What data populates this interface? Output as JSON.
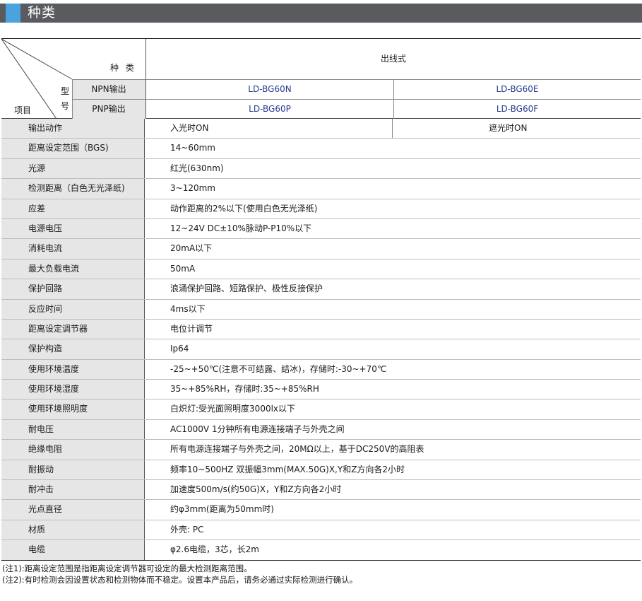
{
  "section_title": "种类",
  "header": {
    "kind_label": "种 类",
    "model_label_1": "型",
    "model_label_2": "号",
    "item_label": "项目",
    "output_type": "出线式",
    "npn_label": "NPN输出",
    "pnp_label": "PNP输出",
    "npn_models": [
      "LD-BG60N",
      "LD-BG60E"
    ],
    "pnp_models": [
      "LD-BG60P",
      "LD-BG60F"
    ]
  },
  "output_action": {
    "label": "输出动作",
    "values": [
      "入光时ON",
      "遮光时ON"
    ]
  },
  "rows": [
    {
      "label": "距离设定范围（BGS)",
      "value": "14~60mm"
    },
    {
      "label": "光源",
      "value": "红光(630nm)"
    },
    {
      "label": "检测距离（白色无光泽纸)",
      "value": "3~120mm"
    },
    {
      "label": "应差",
      "value": "动作距离的2%以下(使用白色无光泽纸)"
    },
    {
      "label": "电源电压",
      "value": "12~24V DC±10%脉动P-P10%以下"
    },
    {
      "label": "消耗电流",
      "value": "20mA以下"
    },
    {
      "label": "最大负载电流",
      "value": "50mA"
    },
    {
      "label": "保护回路",
      "value": "浪涌保护回路、短路保护、极性反接保护"
    },
    {
      "label": "反应时间",
      "value": "4ms以下"
    },
    {
      "label": "距离设定调节器",
      "value": "电位计调节"
    },
    {
      "label": "保护构造",
      "value": "Ip64"
    },
    {
      "label": "使用环境温度",
      "value": "-25~+50℃(注意不可结露、结冰)，存储时:-30~+70℃"
    },
    {
      "label": "使用环境湿度",
      "value": "35~+85%RH，存储时:35~+85%RH"
    },
    {
      "label": "使用环境照明度",
      "value": "白炽灯:受光面照明度3000lx以下"
    },
    {
      "label": "耐电压",
      "value": "AC1000V 1分钟所有电源连接端子与外壳之间"
    },
    {
      "label": "绝缘电阻",
      "value": "所有电源连接端子与外壳之间，20MΩ以上，基于DC250V的高阻表"
    },
    {
      "label": "耐振动",
      "value": "频率10~500HZ 双振幅3mm(MAX.50G)X,Y和Z方向各2小时"
    },
    {
      "label": "耐冲击",
      "value": "加速度500m/s(约50G)X，Y和Z方向各2小时"
    },
    {
      "label": "光点直径",
      "value": "约φ3mm(距离为50mm时)"
    },
    {
      "label": "材质",
      "value": "外壳: PC"
    },
    {
      "label": "电缆",
      "value": "φ2.6电缆，3芯，长2m"
    }
  ],
  "notes": [
    "(注1):距离设定范围是指距离设定调节器可设定的最大检测距离范围。",
    "(注2):有时检测会因设置状态和检测物体而不稳定。设置本产品后，请务必通过实际检测进行确认。"
  ],
  "colors": {
    "title_bar": "#595b5e",
    "accent": "#4aa3df",
    "model_text": "#243b8f",
    "label_bg": "#e6e6e6"
  }
}
